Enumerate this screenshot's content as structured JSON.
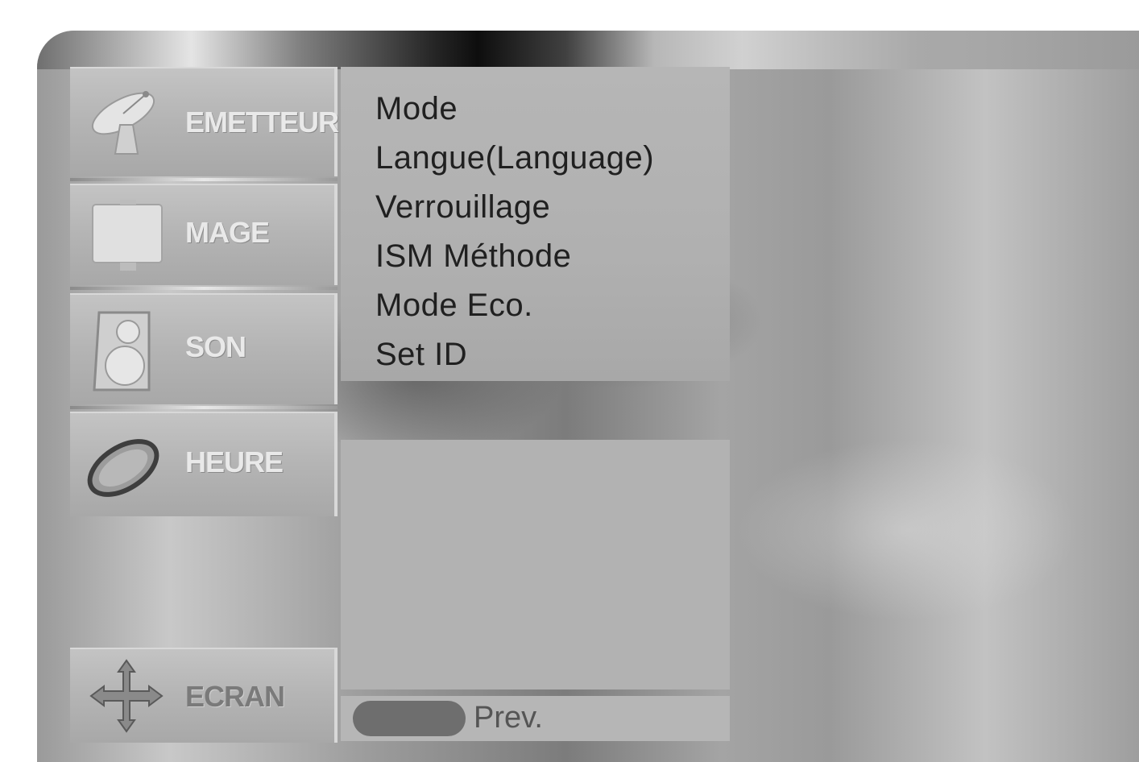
{
  "sidebar": {
    "items": [
      {
        "label": "EMETTEUR",
        "icon": "satellite-dish-icon"
      },
      {
        "label": "MAGE",
        "icon": "picture-screen-icon"
      },
      {
        "label": "SON",
        "icon": "speaker-icon"
      },
      {
        "label": "HEURE",
        "icon": "clock-icon"
      },
      {
        "label": "ECRAN",
        "icon": "move-arrows-icon"
      }
    ]
  },
  "submenu": {
    "items": [
      "Mode",
      "Langue(Language)",
      "Verrouillage",
      "ISM Méthode",
      "Mode Eco.",
      "Set ID"
    ]
  },
  "hint": {
    "button_color": "#6e6e6e",
    "label": "Prev."
  }
}
